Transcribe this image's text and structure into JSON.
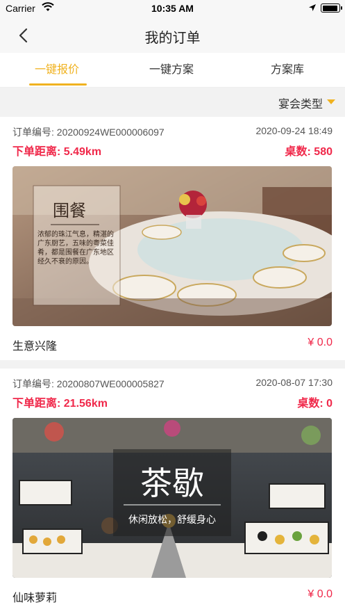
{
  "status_bar": {
    "carrier": "Carrier",
    "time": "10:35 AM"
  },
  "nav": {
    "title": "我的订单"
  },
  "tabs": [
    {
      "label": "一键报价",
      "active": true
    },
    {
      "label": "一键方案",
      "active": false
    },
    {
      "label": "方案库",
      "active": false
    }
  ],
  "filter": {
    "label": "宴会类型"
  },
  "orders": [
    {
      "order_no": "订单编号: 20200924WE000006097",
      "datetime": "2020-09-24 18:49",
      "distance": "下单距离: 5.49km",
      "tables": "桌数: 580",
      "image_title": "围餐",
      "image_text": "浓郁的珠江气息，精湛的广东厨艺，五味的粤菜佳肴，都是围餐在广东地区经久不衰的原因。",
      "name": "生意兴隆",
      "price": "¥ 0.0"
    },
    {
      "order_no": "订单编号: 20200807WE000005827",
      "datetime": "2020-08-07 17:30",
      "distance": "下单距离: 21.56km",
      "tables": "桌数: 0",
      "image_title": "茶歇",
      "image_subtitle": "休闲放松，舒缓身心",
      "name": "仙味萝莉",
      "price": "¥ 0.0"
    }
  ],
  "colors": {
    "accent": "#f0b21f",
    "highlight": "#f0284a"
  }
}
